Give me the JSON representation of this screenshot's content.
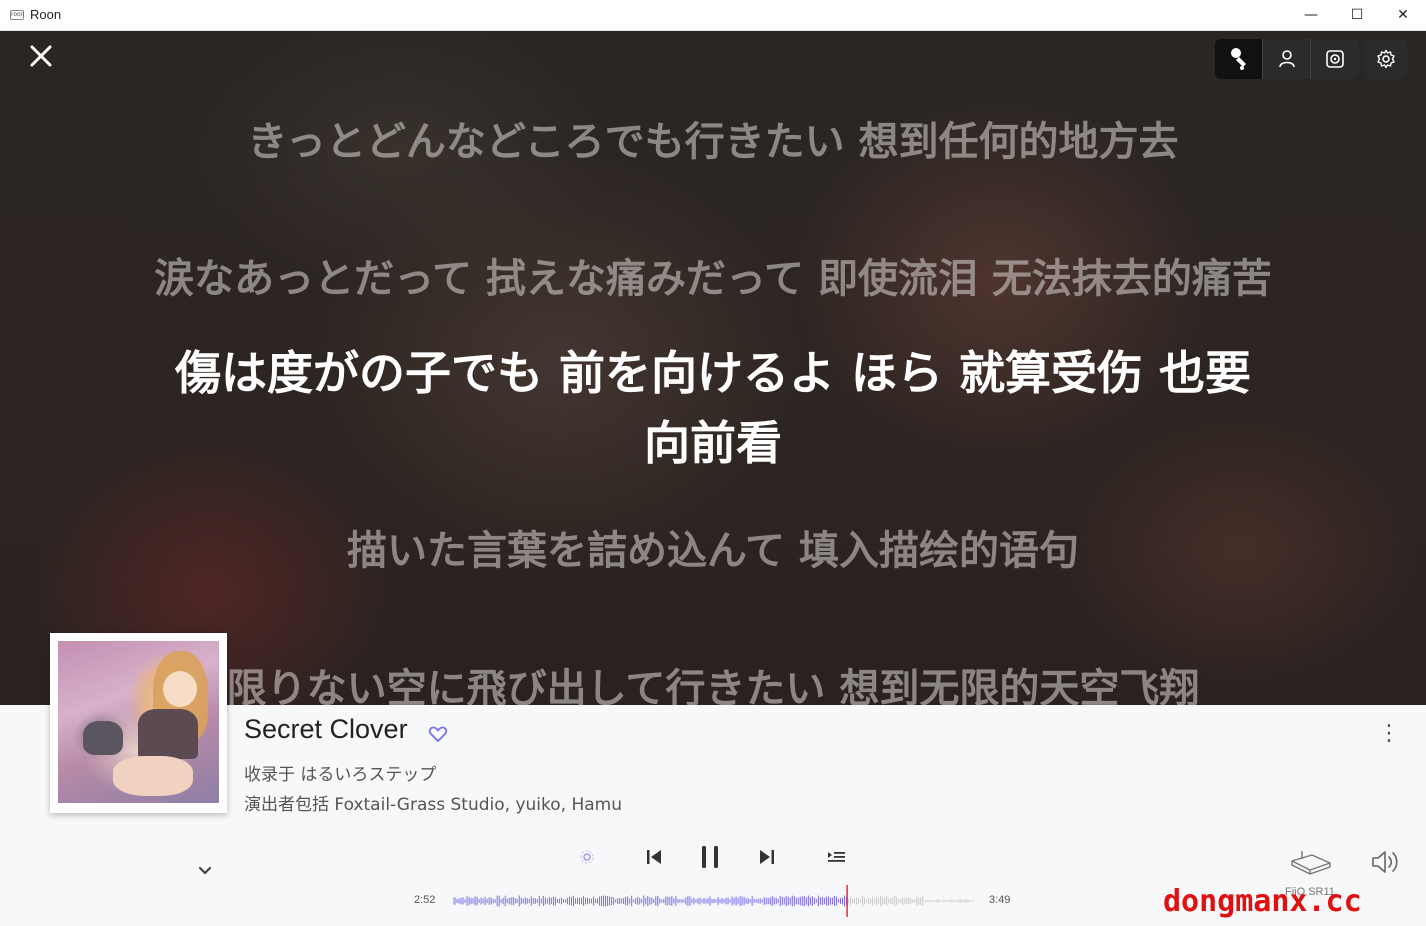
{
  "window": {
    "title": "Roon",
    "icon_text": "roon",
    "minimize": "—",
    "maximize": "☐",
    "close": "✕"
  },
  "lyrics": {
    "close_icon": "close-icon",
    "lines": [
      "きっとどんなどころでも行きたい  想到任何的地方去",
      "涙なあっとだって 拭えな痛みだって  即使流泪 无法抹去的痛苦",
      "傷は度がの子でも 前を向けるよ   ほら  就算受伤 也要",
      "向前看",
      "描いた言葉を詰め込んて  填入描绘的语句",
      "限りない空に飛び出して行きたい  想到无限的天空飞翔"
    ],
    "tools": [
      "singer-icon",
      "person-icon",
      "speaker-icon",
      "gear-icon"
    ]
  },
  "now_playing": {
    "title": "Secret Clover",
    "album_line": "收录于 はるいろステップ",
    "artist_line": "演出者包括 Foxtail-Grass Studio, yuiko, Hamu",
    "more": "⋮",
    "elapsed": "2:52",
    "total": "3:49",
    "progress": 0.755,
    "zone": "FiiO SR11",
    "accent": "#7b6cf0",
    "progress_marker_color": "#e03030"
  },
  "watermark": "dongmanx.cc"
}
